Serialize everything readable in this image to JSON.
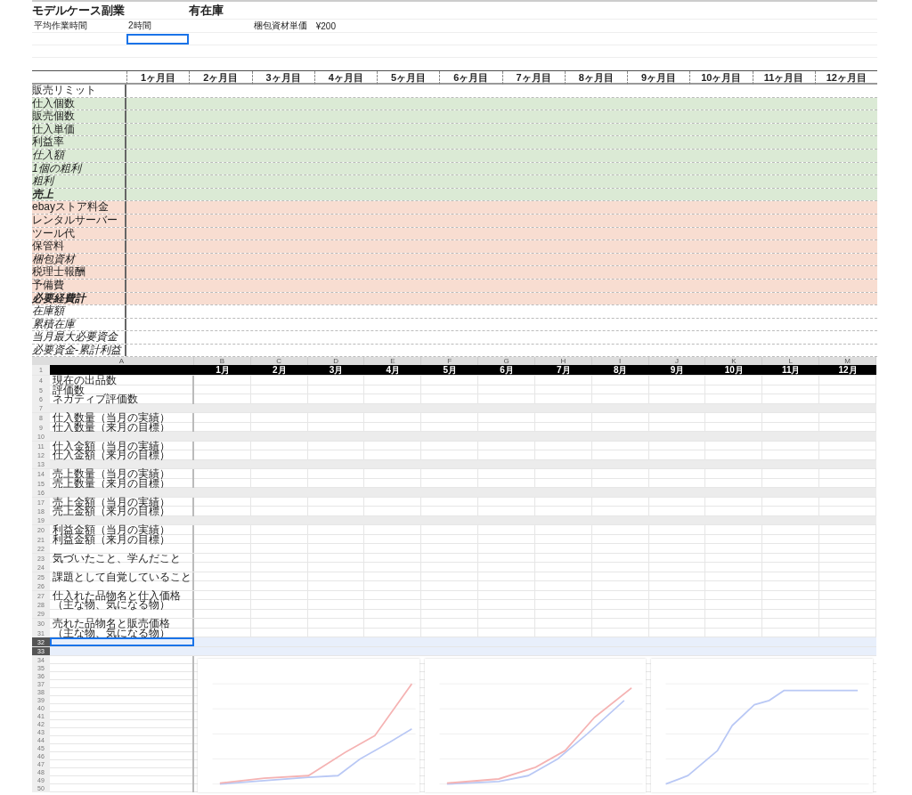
{
  "planner": {
    "title": "モデルケース副業",
    "subtitle": "有在庫",
    "params": [
      {
        "label": "平均作業時間",
        "value": "2時間"
      },
      {
        "label": "梱包資材単価",
        "value": "¥200"
      }
    ],
    "blank_rows": [
      {
        "selected": true
      },
      {
        "selected": false
      },
      {
        "selected": false
      }
    ],
    "columns": [
      "1ヶ月目",
      "2ヶ月目",
      "3ヶ月目",
      "4ヶ月目",
      "5ヶ月目",
      "6ヶ月目",
      "7ヶ月目",
      "8ヶ月目",
      "9ヶ月目",
      "10ヶ月目",
      "11ヶ月目",
      "12ヶ月目"
    ],
    "rows": [
      {
        "label": "販売リミット",
        "kind": "plain"
      },
      {
        "label": "仕入個数",
        "kind": "income"
      },
      {
        "label": "販売個数",
        "kind": "income"
      },
      {
        "label": "仕入単価",
        "kind": "income"
      },
      {
        "label": "利益率",
        "kind": "income"
      },
      {
        "label": "仕入額",
        "kind": "incomecalc"
      },
      {
        "label": "1個の粗利",
        "kind": "incomecalc"
      },
      {
        "label": "粗利",
        "kind": "incomecalc"
      },
      {
        "label": "売上",
        "kind": "incometotal"
      },
      {
        "label": "ebayストア料金",
        "kind": "expense"
      },
      {
        "label": "レンタルサーバー",
        "kind": "expense"
      },
      {
        "label": "ツール代",
        "kind": "expense"
      },
      {
        "label": "保管料",
        "kind": "expense"
      },
      {
        "label": "梱包資材",
        "kind": "expensecalc"
      },
      {
        "label": "税理士報酬",
        "kind": "expense"
      },
      {
        "label": "予備費",
        "kind": "expense"
      },
      {
        "label": "必要経費計",
        "kind": "expensetotal"
      },
      {
        "label": "在庫額",
        "kind": "calc"
      },
      {
        "label": "累積在庫",
        "kind": "calc"
      },
      {
        "label": "当月最大必要資金",
        "kind": "calc"
      },
      {
        "label": "必要資金-累計利益",
        "kind": "calc"
      }
    ]
  },
  "tracker": {
    "column_letters": [
      "A",
      "B",
      "C",
      "D",
      "E",
      "F",
      "G",
      "H",
      "I",
      "J",
      "K",
      "L",
      "M"
    ],
    "header_row": "1",
    "months": [
      "1月",
      "2月",
      "3月",
      "4月",
      "5月",
      "6月",
      "7月",
      "8月",
      "9月",
      "10月",
      "11月",
      "12月"
    ],
    "rows": [
      {
        "number": "4",
        "kind": "item",
        "label": "現在の出品数",
        "selected": false
      },
      {
        "number": "5",
        "kind": "item",
        "label": "評価数",
        "selected": false
      },
      {
        "number": "6",
        "kind": "item",
        "label": "ネガティブ評価数",
        "selected": false
      },
      {
        "number": "7",
        "kind": "gap",
        "selected": false
      },
      {
        "number": "8",
        "kind": "item",
        "label": "仕入数量（当月の実績）",
        "selected": false
      },
      {
        "number": "9",
        "kind": "item",
        "label": "仕入数量（来月の目標）",
        "selected": false
      },
      {
        "number": "10",
        "kind": "gap",
        "selected": false
      },
      {
        "number": "11",
        "kind": "item",
        "label": "仕入金額（当月の実績）",
        "selected": false
      },
      {
        "number": "12",
        "kind": "item",
        "label": "仕入金額（来月の目標）",
        "selected": false
      },
      {
        "number": "13",
        "kind": "gap",
        "selected": false
      },
      {
        "number": "14",
        "kind": "item",
        "label": "売上数量（当月の実績）",
        "selected": false
      },
      {
        "number": "15",
        "kind": "item",
        "label": "売上数量（来月の目標）",
        "selected": false
      },
      {
        "number": "16",
        "kind": "gap",
        "selected": false
      },
      {
        "number": "17",
        "kind": "item",
        "label": "売上金額（当月の実績）",
        "selected": false
      },
      {
        "number": "18",
        "kind": "item",
        "label": "売上金額（来月の目標）",
        "selected": false
      },
      {
        "number": "19",
        "kind": "gap",
        "selected": false
      },
      {
        "number": "20",
        "kind": "item",
        "label": "利益金額（当月の実績）",
        "selected": false
      },
      {
        "number": "21",
        "kind": "item",
        "label": "利益金額（来月の目標）",
        "selected": false
      },
      {
        "number": "22",
        "kind": "blank",
        "selected": false
      },
      {
        "number": "23",
        "kind": "item",
        "label": "気づいたこと、学んだこと",
        "selected": false
      },
      {
        "number": "24",
        "kind": "blank",
        "selected": false
      },
      {
        "number": "25",
        "kind": "item",
        "label": "課題として自覚していること",
        "selected": false
      },
      {
        "number": "26",
        "kind": "blank",
        "selected": false
      },
      {
        "number": "27",
        "kind": "item",
        "label": "仕入れた品物名と仕入価格",
        "selected": false
      },
      {
        "number": "28",
        "kind": "item",
        "label": "（主な物、気になる物）",
        "selected": false
      },
      {
        "number": "29",
        "kind": "blank",
        "selected": false
      },
      {
        "number": "30",
        "kind": "item",
        "label": "売れた品物名と販売価格",
        "selected": false
      },
      {
        "number": "31",
        "kind": "item",
        "label": "（主な物、気になる物）",
        "selected": false
      },
      {
        "number": "32",
        "kind": "blank",
        "selected": true
      },
      {
        "number": "33",
        "kind": "blank",
        "selected": true
      }
    ],
    "chart_rows": [
      "34",
      "35",
      "36",
      "37",
      "38",
      "39",
      "40",
      "41",
      "42",
      "43",
      "44",
      "45",
      "46",
      "47",
      "48",
      "49",
      "50"
    ],
    "charts": [
      {
        "kind": "two-line"
      },
      {
        "kind": "two-line"
      },
      {
        "kind": "one-line"
      }
    ]
  }
}
